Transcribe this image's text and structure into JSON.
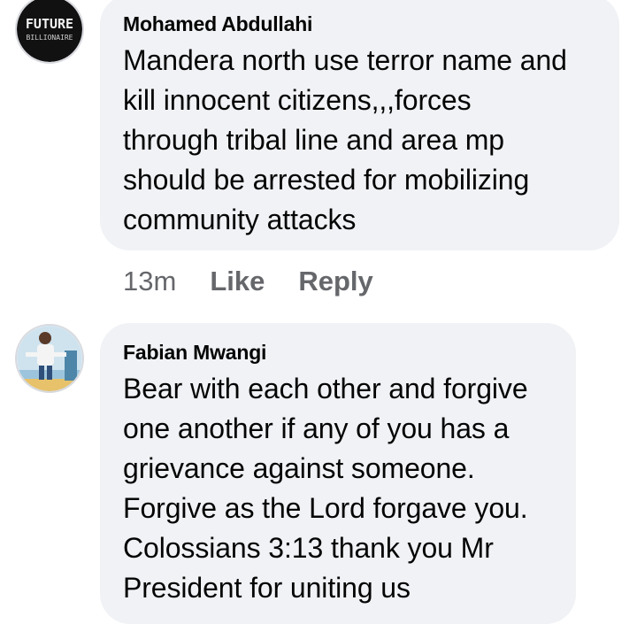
{
  "comments": [
    {
      "author": "Mohamed Abdullahi",
      "text": "Mandera north use terror name and\nkill innocent citizens,,,forces\nthrough tribal line and area mp\nshould be arrested for mobilizing\ncommunity attacks",
      "avatar_text_line1": "FUTURE",
      "avatar_text_line2": "BILLIONAIRE",
      "time": "13m",
      "like_label": "Like",
      "reply_label": "Reply"
    },
    {
      "author": "Fabian Mwangi",
      "text": "Bear with each other and forgive\none another if any of you has a\ngrievance against someone.\nForgive as the Lord forgave you.\nColossians 3:13 thank you Mr\nPresident for uniting us"
    }
  ],
  "colors": {
    "bubble": "#f0f2f5",
    "text": "#050505",
    "meta": "#65676b"
  }
}
